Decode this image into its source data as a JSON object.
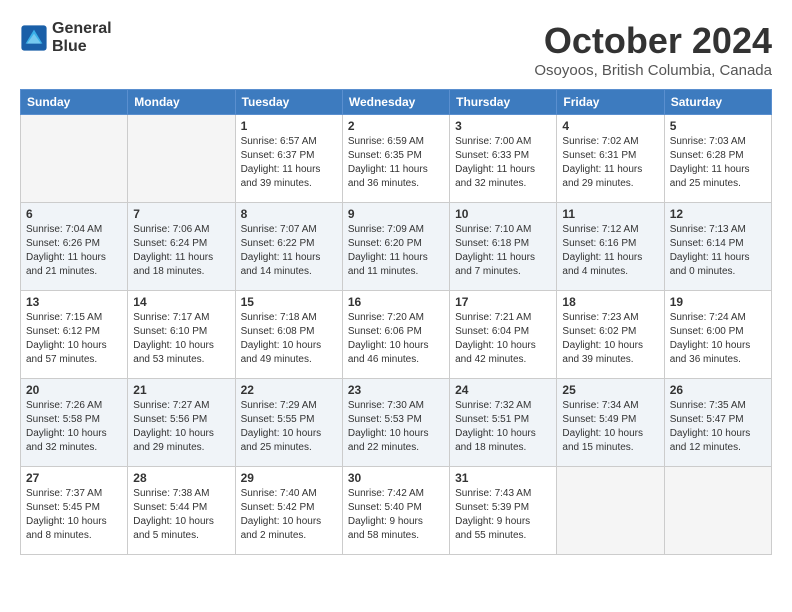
{
  "header": {
    "logo_line1": "General",
    "logo_line2": "Blue",
    "month": "October 2024",
    "location": "Osoyoos, British Columbia, Canada"
  },
  "days_of_week": [
    "Sunday",
    "Monday",
    "Tuesday",
    "Wednesday",
    "Thursday",
    "Friday",
    "Saturday"
  ],
  "weeks": [
    [
      {
        "day": "",
        "info": ""
      },
      {
        "day": "",
        "info": ""
      },
      {
        "day": "1",
        "info": "Sunrise: 6:57 AM\nSunset: 6:37 PM\nDaylight: 11 hours\nand 39 minutes."
      },
      {
        "day": "2",
        "info": "Sunrise: 6:59 AM\nSunset: 6:35 PM\nDaylight: 11 hours\nand 36 minutes."
      },
      {
        "day": "3",
        "info": "Sunrise: 7:00 AM\nSunset: 6:33 PM\nDaylight: 11 hours\nand 32 minutes."
      },
      {
        "day": "4",
        "info": "Sunrise: 7:02 AM\nSunset: 6:31 PM\nDaylight: 11 hours\nand 29 minutes."
      },
      {
        "day": "5",
        "info": "Sunrise: 7:03 AM\nSunset: 6:28 PM\nDaylight: 11 hours\nand 25 minutes."
      }
    ],
    [
      {
        "day": "6",
        "info": "Sunrise: 7:04 AM\nSunset: 6:26 PM\nDaylight: 11 hours\nand 21 minutes."
      },
      {
        "day": "7",
        "info": "Sunrise: 7:06 AM\nSunset: 6:24 PM\nDaylight: 11 hours\nand 18 minutes."
      },
      {
        "day": "8",
        "info": "Sunrise: 7:07 AM\nSunset: 6:22 PM\nDaylight: 11 hours\nand 14 minutes."
      },
      {
        "day": "9",
        "info": "Sunrise: 7:09 AM\nSunset: 6:20 PM\nDaylight: 11 hours\nand 11 minutes."
      },
      {
        "day": "10",
        "info": "Sunrise: 7:10 AM\nSunset: 6:18 PM\nDaylight: 11 hours\nand 7 minutes."
      },
      {
        "day": "11",
        "info": "Sunrise: 7:12 AM\nSunset: 6:16 PM\nDaylight: 11 hours\nand 4 minutes."
      },
      {
        "day": "12",
        "info": "Sunrise: 7:13 AM\nSunset: 6:14 PM\nDaylight: 11 hours\nand 0 minutes."
      }
    ],
    [
      {
        "day": "13",
        "info": "Sunrise: 7:15 AM\nSunset: 6:12 PM\nDaylight: 10 hours\nand 57 minutes."
      },
      {
        "day": "14",
        "info": "Sunrise: 7:17 AM\nSunset: 6:10 PM\nDaylight: 10 hours\nand 53 minutes."
      },
      {
        "day": "15",
        "info": "Sunrise: 7:18 AM\nSunset: 6:08 PM\nDaylight: 10 hours\nand 49 minutes."
      },
      {
        "day": "16",
        "info": "Sunrise: 7:20 AM\nSunset: 6:06 PM\nDaylight: 10 hours\nand 46 minutes."
      },
      {
        "day": "17",
        "info": "Sunrise: 7:21 AM\nSunset: 6:04 PM\nDaylight: 10 hours\nand 42 minutes."
      },
      {
        "day": "18",
        "info": "Sunrise: 7:23 AM\nSunset: 6:02 PM\nDaylight: 10 hours\nand 39 minutes."
      },
      {
        "day": "19",
        "info": "Sunrise: 7:24 AM\nSunset: 6:00 PM\nDaylight: 10 hours\nand 36 minutes."
      }
    ],
    [
      {
        "day": "20",
        "info": "Sunrise: 7:26 AM\nSunset: 5:58 PM\nDaylight: 10 hours\nand 32 minutes."
      },
      {
        "day": "21",
        "info": "Sunrise: 7:27 AM\nSunset: 5:56 PM\nDaylight: 10 hours\nand 29 minutes."
      },
      {
        "day": "22",
        "info": "Sunrise: 7:29 AM\nSunset: 5:55 PM\nDaylight: 10 hours\nand 25 minutes."
      },
      {
        "day": "23",
        "info": "Sunrise: 7:30 AM\nSunset: 5:53 PM\nDaylight: 10 hours\nand 22 minutes."
      },
      {
        "day": "24",
        "info": "Sunrise: 7:32 AM\nSunset: 5:51 PM\nDaylight: 10 hours\nand 18 minutes."
      },
      {
        "day": "25",
        "info": "Sunrise: 7:34 AM\nSunset: 5:49 PM\nDaylight: 10 hours\nand 15 minutes."
      },
      {
        "day": "26",
        "info": "Sunrise: 7:35 AM\nSunset: 5:47 PM\nDaylight: 10 hours\nand 12 minutes."
      }
    ],
    [
      {
        "day": "27",
        "info": "Sunrise: 7:37 AM\nSunset: 5:45 PM\nDaylight: 10 hours\nand 8 minutes."
      },
      {
        "day": "28",
        "info": "Sunrise: 7:38 AM\nSunset: 5:44 PM\nDaylight: 10 hours\nand 5 minutes."
      },
      {
        "day": "29",
        "info": "Sunrise: 7:40 AM\nSunset: 5:42 PM\nDaylight: 10 hours\nand 2 minutes."
      },
      {
        "day": "30",
        "info": "Sunrise: 7:42 AM\nSunset: 5:40 PM\nDaylight: 9 hours\nand 58 minutes."
      },
      {
        "day": "31",
        "info": "Sunrise: 7:43 AM\nSunset: 5:39 PM\nDaylight: 9 hours\nand 55 minutes."
      },
      {
        "day": "",
        "info": ""
      },
      {
        "day": "",
        "info": ""
      }
    ]
  ]
}
